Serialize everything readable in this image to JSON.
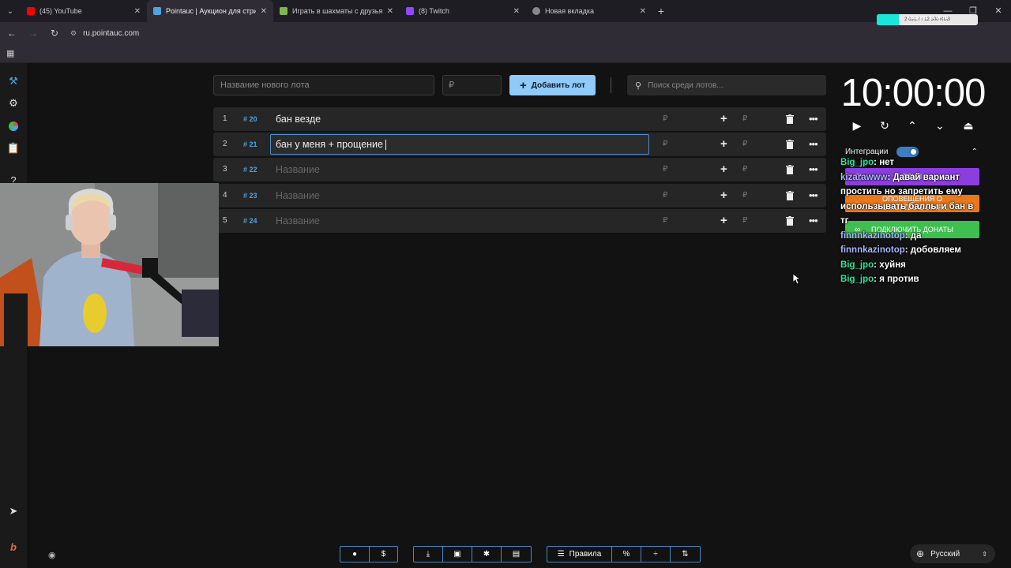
{
  "browser": {
    "tabs": [
      {
        "label": "(45) YouTube",
        "favicon_color": "#ff0000",
        "active": false
      },
      {
        "label": "Pointauc | Аукцион для стримеров",
        "favicon_color": "#4fa3e0",
        "active": true
      },
      {
        "label": "Играть в шахматы с друзьями",
        "favicon_color": "#81b64c",
        "active": false
      },
      {
        "label": "(8) Twitch",
        "favicon_color": "#9146ff",
        "active": false
      },
      {
        "label": "Новая вкладка",
        "favicon_color": "#888888",
        "active": false
      }
    ],
    "url": "ru.pointauc.com",
    "donation_goal": {
      "title": "СБОРНИК НА ПРОЩ",
      "text": "2 691.7 / 12 300 RUB",
      "progress": 0.22
    }
  },
  "toolbar": {
    "lot_name_placeholder": "Название нового лота",
    "amount_placeholder": "₽",
    "add_button_label": "Добавить лот",
    "search_placeholder": "Поиск среди лотов..."
  },
  "lots": [
    {
      "index": "1",
      "fast_id": "# 20",
      "name": "бан везде",
      "placeholder": false,
      "editing": false
    },
    {
      "index": "2",
      "fast_id": "# 21",
      "name": "бан у меня + прощение",
      "placeholder": false,
      "editing": true
    },
    {
      "index": "3",
      "fast_id": "# 22",
      "name": "Название",
      "placeholder": true,
      "editing": false
    },
    {
      "index": "4",
      "fast_id": "# 23",
      "name": "Название",
      "placeholder": true,
      "editing": false
    },
    {
      "index": "5",
      "fast_id": "# 24",
      "name": "Название",
      "placeholder": true,
      "editing": false
    }
  ],
  "currency_symbol": "₽",
  "timer": {
    "value": "10:00:00"
  },
  "integrations": {
    "label": "Интеграции",
    "enabled": true,
    "buttons": [
      {
        "label": "ТВИЧ",
        "color": "#8a3ee0"
      },
      {
        "label": "ОПОВЕЩЕНИЯ О ПОЖЕРТВОВАНИЯХ",
        "color": "#e8781b"
      },
      {
        "label": "ПОДКЛЮЧИТЬ ДОНАТЫ",
        "color": "#3fbf4f"
      }
    ]
  },
  "chat": [
    {
      "user": "Big_jpo",
      "message": "нет",
      "color": "#2ee69a"
    },
    {
      "user": "kizarawww",
      "message": "Давай вариант простить но запретить ему использывать баллы и бан в тг",
      "color": "#a9b6ff"
    },
    {
      "user": "finnnkazinotop",
      "message": "да",
      "color": "#a9b6ff"
    },
    {
      "user": "finnnkazinotop",
      "message": "добовляем",
      "color": "#a9b6ff"
    },
    {
      "user": "Big_jpo",
      "message": "хуйня",
      "color": "#2ee69a"
    },
    {
      "user": "Big_jpo",
      "message": "я против",
      "color": "#2ee69a"
    }
  ],
  "bottom": {
    "rules_label": "Правила",
    "language": "Русский"
  }
}
